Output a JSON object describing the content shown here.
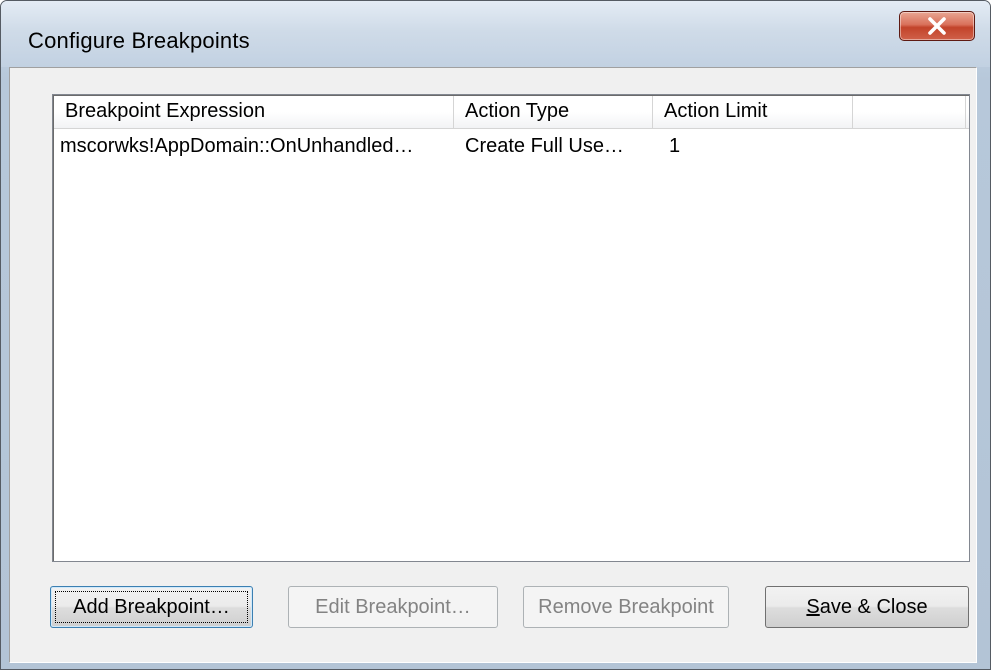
{
  "window": {
    "title": "Configure Breakpoints",
    "close_label": "X"
  },
  "breakpoints_list": {
    "columns": [
      "Breakpoint Expression",
      "Action Type",
      "Action Limit",
      ""
    ],
    "rows": [
      {
        "expression": "mscorwks!AppDomain::OnUnhandled…",
        "action_type": "Create Full Use…",
        "action_limit": "1"
      }
    ]
  },
  "buttons": {
    "add": "Add Breakpoint…",
    "edit": "Edit Breakpoint…",
    "remove": "Remove Breakpoint",
    "save_close_mnemonic": "S",
    "save_close_rest": "ave & Close"
  },
  "colors": {
    "close_button": "#c2432a",
    "dialog_face": "#f0f0f0",
    "disabled_text": "#838383"
  }
}
